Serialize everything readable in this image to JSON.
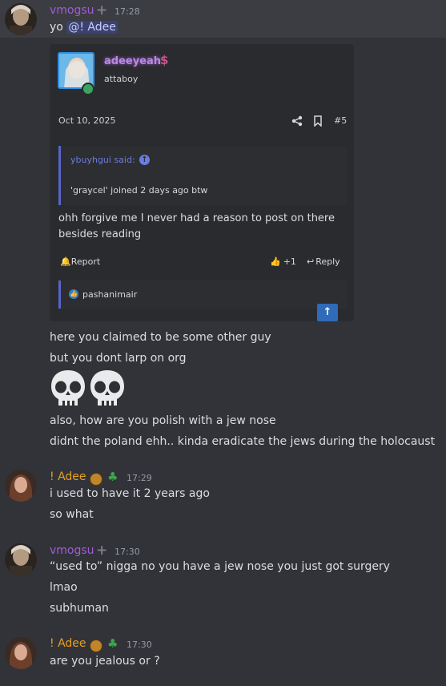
{
  "msg1": {
    "author": "vmogsu",
    "time": "17:28",
    "mention_prefix": "yo",
    "mention": "@! Adee",
    "author_color": "#a35bd6"
  },
  "embed": {
    "poster": "adeeyeah",
    "subtitle": "attaboy",
    "date": "Oct 10, 2025",
    "post_number": "#5",
    "quote_author": "ybuyhgui said:",
    "quote_text": "'graycel' joined 2 days ago btw",
    "body_line1": "ohh forgive me I never had a reason to post on there",
    "body_line2": "besides reading",
    "report_label": "Report",
    "like_count": "+1",
    "reply_label": "Reply",
    "reactor": "pashanimair"
  },
  "msg1_lines": [
    "here you claimed to be some other guy",
    "but you dont larp on org",
    "also, how are you polish with a jew nose",
    "didnt the poland ehh.. kinda eradicate the jews during the holocaust"
  ],
  "msg2": {
    "author": "! Adee",
    "time": "17:29",
    "lines": [
      "i used to have it 2 years ago",
      "so what"
    ],
    "author_color": "#e8a020"
  },
  "msg3": {
    "author": "vmogsu",
    "time": "17:30",
    "lines": [
      "“used to” nigga no you have a jew nose you just got surgery",
      "lmao",
      "subhuman"
    ]
  },
  "msg4": {
    "author": "! Adee",
    "time": "17:30",
    "lines": [
      "are you jealous or ?"
    ]
  }
}
